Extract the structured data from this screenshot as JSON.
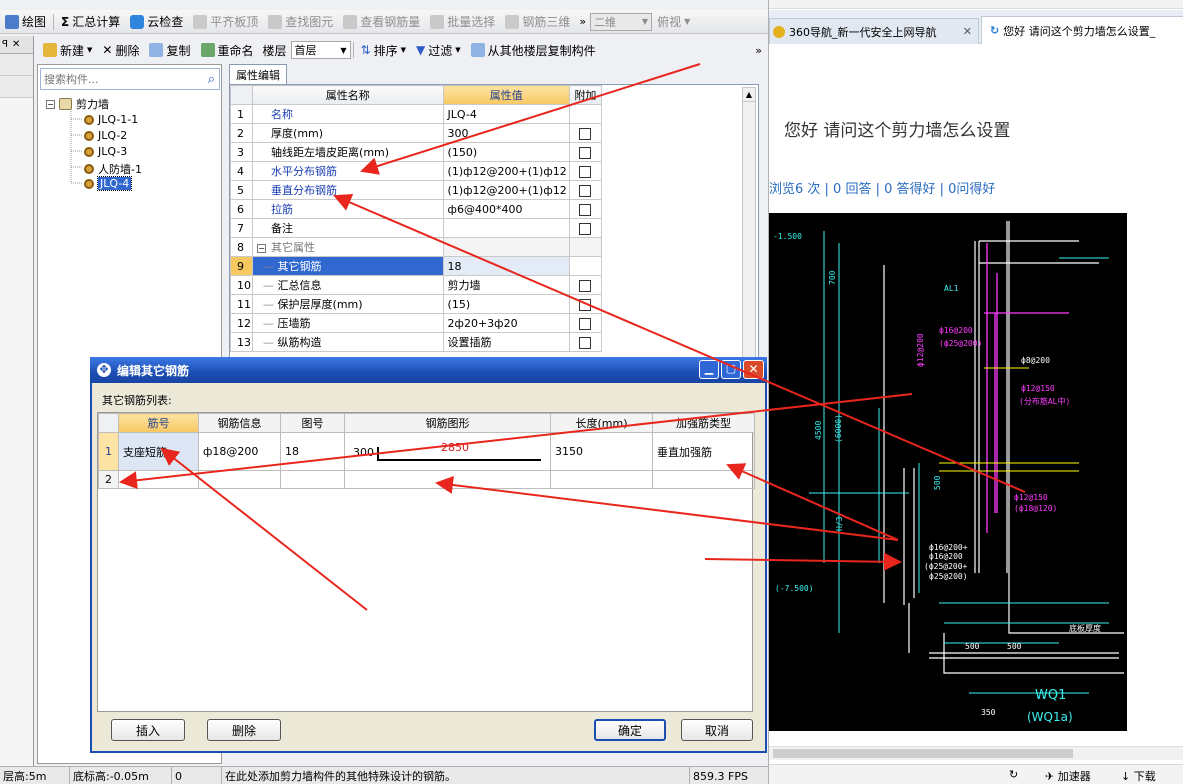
{
  "toolbar1": {
    "items": [
      {
        "label": "绘图",
        "icon": "draw-icon",
        "disabled": false
      },
      {
        "label": "汇总计算",
        "icon": "sigma-icon",
        "disabled": false
      },
      {
        "label": "云检查",
        "icon": "cloud-check-icon",
        "disabled": false
      },
      {
        "label": "平齐板顶",
        "icon": "align-icon",
        "disabled": true
      },
      {
        "label": "查找图元",
        "icon": "binoculars-icon",
        "disabled": true
      },
      {
        "label": "查看钢筋量",
        "icon": "rebar-view-icon",
        "disabled": true
      },
      {
        "label": "批量选择",
        "icon": "batch-select-icon",
        "disabled": true
      },
      {
        "label": "钢筋三维",
        "icon": "rebar-3d-icon",
        "disabled": true
      }
    ],
    "view_mode": "二维",
    "view_dir": "俯视"
  },
  "toolbar2": {
    "new_label": "新建",
    "delete_label": "删除",
    "copy_label": "复制",
    "rename_label": "重命名",
    "floor_label": "楼层",
    "floor_value": "首层",
    "sort_label": "排序",
    "filter_label": "过滤",
    "copy_from_floor_label": "从其他楼层复制构件"
  },
  "search": {
    "placeholder": "搜索构件..."
  },
  "tree": {
    "root": "剪力墙",
    "items": [
      "JLQ-1-1",
      "JLQ-2",
      "JLQ-3",
      "人防墙-1",
      "JLQ-4"
    ],
    "selected_index": 4
  },
  "property_panel": {
    "tab": "属性编辑",
    "headers": [
      "属性名称",
      "属性值",
      "附加"
    ],
    "rows": [
      {
        "no": "1",
        "name": "名称",
        "value": "JLQ-4",
        "link": true,
        "indent": 0,
        "checkbox": false
      },
      {
        "no": "2",
        "name": "厚度(mm)",
        "value": "300",
        "link": false,
        "indent": 0,
        "checkbox": true
      },
      {
        "no": "3",
        "name": "轴线距左墙皮距离(mm)",
        "value": "(150)",
        "link": false,
        "indent": 0,
        "checkbox": true
      },
      {
        "no": "4",
        "name": "水平分布钢筋",
        "value": "(1)ф12@200+(1)ф12",
        "link": true,
        "indent": 0,
        "checkbox": true
      },
      {
        "no": "5",
        "name": "垂直分布钢筋",
        "value": "(1)ф12@200+(1)ф12",
        "link": true,
        "indent": 0,
        "checkbox": true
      },
      {
        "no": "6",
        "name": "拉筋",
        "value": "ф6@400*400",
        "link": true,
        "indent": 0,
        "checkbox": true
      },
      {
        "no": "7",
        "name": "备注",
        "value": "",
        "link": false,
        "indent": 0,
        "checkbox": true
      },
      {
        "no": "8",
        "name": "其它属性",
        "value": "",
        "link": false,
        "indent": 0,
        "checkbox": false,
        "group": true
      },
      {
        "no": "9",
        "name": "其它钢筋",
        "value": "18",
        "link": false,
        "indent": 1,
        "checkbox": false,
        "selected": true
      },
      {
        "no": "10",
        "name": "汇总信息",
        "value": "剪力墙",
        "link": false,
        "indent": 1,
        "checkbox": true
      },
      {
        "no": "11",
        "name": "保护层厚度(mm)",
        "value": "(15)",
        "link": false,
        "indent": 1,
        "checkbox": true
      },
      {
        "no": "12",
        "name": "压墙筋",
        "value": "2ф20+3ф20",
        "link": false,
        "indent": 1,
        "checkbox": true
      },
      {
        "no": "13",
        "name": "纵筋构造",
        "value": "设置插筋",
        "link": false,
        "indent": 1,
        "checkbox": true
      }
    ]
  },
  "dialog": {
    "title": "编辑其它钢筋",
    "list_label": "其它钢筋列表:",
    "headers": [
      "筋号",
      "钢筋信息",
      "图号",
      "钢筋图形",
      "长度(mm)",
      "加强筋类型"
    ],
    "rows": [
      {
        "no": "1",
        "bar_no": "支座短筋",
        "info": "ф18@200",
        "fig": "18",
        "shape_left": "300",
        "shape_len": "2850",
        "length": "3150",
        "type": "垂直加强筋"
      },
      {
        "no": "2",
        "bar_no": "",
        "info": "",
        "fig": "",
        "shape_left": "",
        "shape_len": "",
        "length": "",
        "type": ""
      }
    ],
    "buttons": {
      "insert": "插入",
      "delete": "删除",
      "ok": "确定",
      "cancel": "取消"
    }
  },
  "statusbar": {
    "items": [
      "层高:5m",
      "底标高:-0.05m",
      "0",
      "在此处添加剪力墙构件的其他特殊设计的钢筋。",
      "859.3 FPS"
    ]
  },
  "browser": {
    "tabs": [
      "360导航_新一代安全上网导航",
      "您好 请问这个剪力墙怎么设置_"
    ],
    "question_title": "您好 请问这个剪力墙怎么设置",
    "stats": "浏览6 次 | 0 回答 | 0 答得好 | 0问得好",
    "accelerator": "加速器",
    "download": "下载"
  },
  "drawing": {
    "labels": [
      "-1.500",
      "700",
      "AL1",
      "ф16@200",
      "(ф25@200)",
      "ф12@200",
      "ф8@200",
      "ф12@150",
      "(分布筋AL中)",
      "4500",
      "(6000)",
      "ф12@150",
      "(ф18@120)",
      "500",
      "ф16@200+",
      "ф16@200",
      "(ф25@200+",
      "ф25@200)",
      "H/3",
      "(-7.500)",
      "500",
      "500",
      "底板厚度",
      "WQ1",
      "(WQ1a)",
      "350"
    ]
  },
  "colors": {
    "accent": "#2a5bc7",
    "dialog_title": "#1c4db3",
    "annotation": "#e8261d",
    "selected_row": "#3168d0"
  }
}
